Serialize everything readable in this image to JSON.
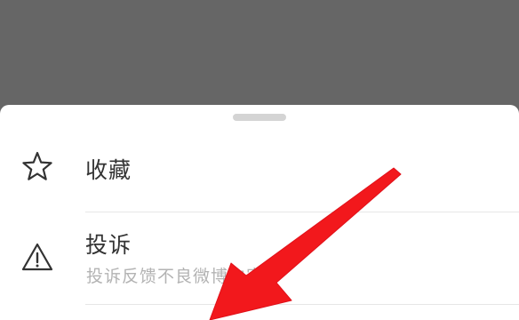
{
  "sheet": {
    "items": [
      {
        "label": "收藏",
        "icon": "star-outline-icon"
      },
      {
        "label": "投诉",
        "sublabel": "投诉反馈不良微博内容",
        "icon": "warning-triangle-icon"
      }
    ]
  },
  "colors": {
    "overlay": "#666666",
    "sheet_background": "#ffffff",
    "handle": "#d4d4d4",
    "label_text": "#333333",
    "sublabel_text": "#b3b3b3",
    "divider": "#e6e6e6",
    "annotation_arrow": "#f2181c"
  }
}
